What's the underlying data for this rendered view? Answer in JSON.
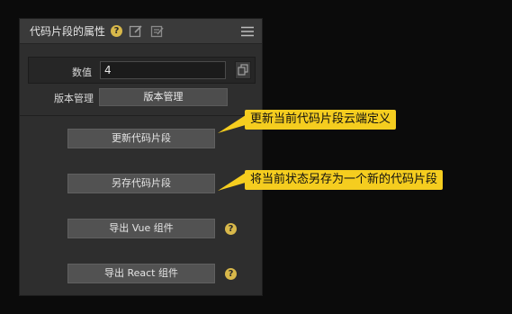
{
  "panel": {
    "title": "代码片段的属性",
    "help_mark": "?",
    "value_label": "数值",
    "value": "4",
    "version_label": "版本管理",
    "version_button": "版本管理",
    "buttons": {
      "update": "更新代码片段",
      "save_as": "另存代码片段",
      "export_vue": "导出 Vue 组件",
      "export_react": "导出 React 组件"
    }
  },
  "callouts": {
    "update": "更新当前代码片段云端定义",
    "save_as": "将当前状态另存为一个新的代码片段"
  },
  "colors": {
    "callout": "#f5cd1f",
    "help": "#d8b84a",
    "panel": "#2e2e2e",
    "button": "#525252"
  },
  "icons": [
    "help-icon",
    "edit-icon",
    "edit-alt-icon",
    "menu-icon",
    "copy-icon"
  ]
}
